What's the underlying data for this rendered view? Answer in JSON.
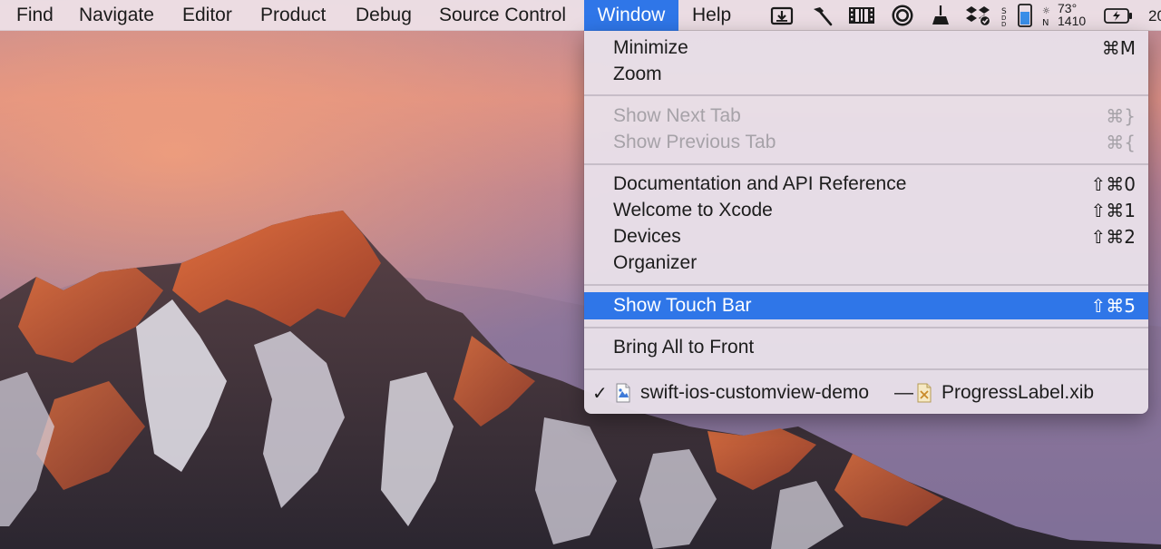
{
  "menubar": {
    "items": [
      {
        "label": "Find"
      },
      {
        "label": "Navigate"
      },
      {
        "label": "Editor"
      },
      {
        "label": "Product"
      },
      {
        "label": "Debug"
      },
      {
        "label": "Source Control"
      },
      {
        "label": "Window",
        "active": true
      },
      {
        "label": "Help"
      }
    ],
    "status": {
      "weather_temp": "73°",
      "weather_value": "1410",
      "clock_fragment": "20",
      "status_icons": [
        "download-icon",
        "hammer-icon",
        "film-icon",
        "record-icon",
        "broom-icon",
        "dropbox-icon",
        "battery-level-icon",
        "weather-icon",
        "battery-charging-icon"
      ]
    }
  },
  "window_menu": {
    "minimize": {
      "label": "Minimize",
      "shortcut": "⌘M"
    },
    "zoom": {
      "label": "Zoom"
    },
    "show_next_tab": {
      "label": "Show Next Tab",
      "shortcut": "⌘}",
      "disabled": true
    },
    "show_previous_tab": {
      "label": "Show Previous Tab",
      "shortcut": "⌘{",
      "disabled": true
    },
    "documentation": {
      "label": "Documentation and API Reference",
      "shortcut": "⇧⌘0"
    },
    "welcome": {
      "label": "Welcome to Xcode",
      "shortcut": "⇧⌘1"
    },
    "devices": {
      "label": "Devices",
      "shortcut": "⇧⌘2"
    },
    "organizer": {
      "label": "Organizer"
    },
    "show_touch_bar": {
      "label": "Show Touch Bar",
      "shortcut": "⇧⌘5",
      "highlighted": true
    },
    "bring_all_to_front": {
      "label": "Bring All to Front"
    },
    "open_window": {
      "check": "✓",
      "project": "swift-ios-customview-demo",
      "separator": "—",
      "file": "ProgressLabel.xib"
    }
  },
  "colors": {
    "highlight": "#2f76e8",
    "menu_text": "#1c1c1c",
    "disabled_text": "#a6a2a8"
  }
}
